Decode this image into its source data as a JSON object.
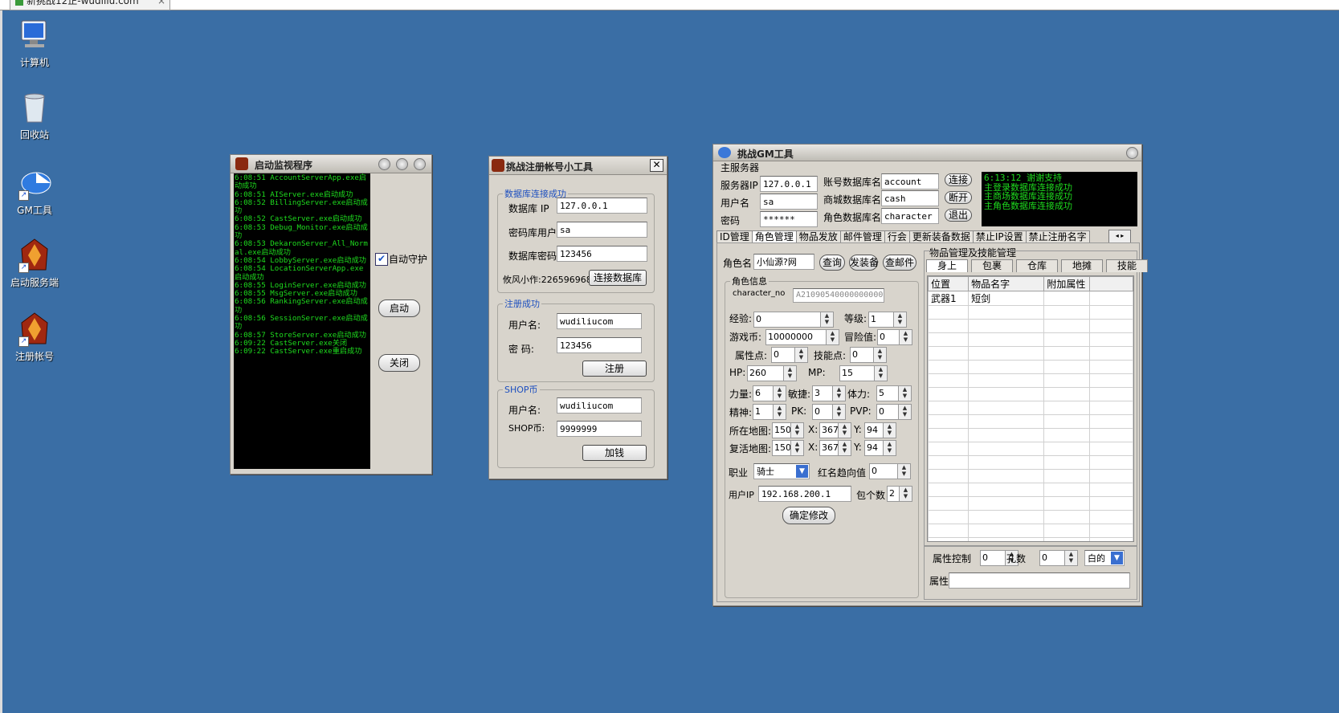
{
  "browser": {
    "tab_title": "新挑战12޸正-wudiliu.com",
    "close": "×"
  },
  "desktop": {
    "icons": [
      {
        "label": "计算机"
      },
      {
        "label": "回收站"
      },
      {
        "label": "GM工具"
      },
      {
        "label": "启动服务端"
      },
      {
        "label": "注册帐号"
      }
    ]
  },
  "monitor": {
    "title": "启动监视程序",
    "log": [
      "6:08:51 AccountServerApp.exe启动成功",
      "6:08:51 AIServer.exe启动成功",
      "6:08:52 BillingServer.exe启动成功",
      "6:08:52 CastServer.exe启动成功",
      "6:08:53 Debug_Monitor.exe启动成功",
      "6:08:53 DekaronServer_All_Normal.exe启动成功",
      "6:08:54 LobbyServer.exe启动成功",
      "6:08:54 LocationServerApp.exe启动成功",
      "6:08:55 LoginServer.exe启动成功",
      "6:08:55 MsgServer.exe启动成功",
      "6:08:56 RankingServer.exe启动成功",
      "6:08:56 SessionServer.exe启动成功",
      "6:08:57 StoreServer.exe启动成功",
      "6:09:22 CastServer.exe关闭",
      "6:09:22 CastServer.exe重启成功"
    ],
    "auto_guard_label": "自动守护",
    "auto_guard_checked": "✔",
    "start_button": "启动",
    "close_button": "关闭"
  },
  "register": {
    "title": "挑战注册帐号小工具",
    "close": "✕",
    "db_group": "数据库连接成功",
    "db_ip_label": "数据库 IP",
    "db_ip": "127.0.0.1",
    "db_user_label": "密码库用户",
    "db_user": "sa",
    "db_pass_label": "数据库密码",
    "db_pass": "123456",
    "credit": "攸风小作:226596968",
    "connect_button": "连接数据库",
    "reg_group": "注册成功",
    "username_label": "用户名:",
    "username": "wudiliucom",
    "password_label": "密  码:",
    "password": "123456",
    "register_button": "注册",
    "shop_group": "SHOP币",
    "shop_user_label": "用户名:",
    "shop_user": "wudiliucom",
    "shop_coin_label": "SHOP币:",
    "shop_coin": "9999999",
    "add_button": "加钱"
  },
  "gm": {
    "title": "挑战GM工具",
    "server_group": "主服务器",
    "server_ip_label": "服务器IP",
    "server_ip": "127.0.0.1",
    "user_label": "用户名",
    "user": "sa",
    "pass_label": "密码",
    "pass": "******",
    "acc_db_label": "账号数据库名",
    "acc_db": "account",
    "shop_db_label": "商城数据库名",
    "shop_db": "cash",
    "char_db_label": "角色数据库名",
    "char_db": "character",
    "connect_button": "连接",
    "disconnect_button": "断开",
    "exit_button": "退出",
    "status": [
      "6:13:12 谢谢支持",
      "主登录数据库连接成功",
      "主商场数据库连接成功",
      "主角色数据库连接成功"
    ],
    "tabs": [
      "ID管理",
      "角色管理",
      "物品发放",
      "邮件管理",
      "行会",
      "更新装备数据",
      "禁止IP设置",
      "禁止注册名字"
    ],
    "char_name_label": "角色名",
    "char_name": "小仙源?网",
    "query_button": "查询",
    "equip_button": "发装备",
    "mail_button": "查邮件",
    "info_group": "角色信息",
    "char_no_label": "character_no",
    "char_no": "A210905400000000001",
    "exp_label": "经验:",
    "exp": "0",
    "level_label": "等级:",
    "level": "1",
    "money_label": "游戏币:",
    "money": "10000000",
    "adventure_label": "冒险值:",
    "adventure": "0",
    "attr_label": "属性点:",
    "attr": "0",
    "skill_pt_label": "技能点:",
    "skill_pt": "0",
    "hp_label": "HP:",
    "hp": "260",
    "mp_label": "MP:",
    "mp": "15",
    "str_label": "力量:",
    "str": "6",
    "agi_label": "敏捷:",
    "agi": "3",
    "vit_label": "体力:",
    "vit": "5",
    "spi_label": "精神:",
    "spi": "1",
    "pk_label": "PK:",
    "pk": "0",
    "pvp_label": "PVP:",
    "pvp": "0",
    "map_label": "所在地图:",
    "map": "150",
    "x_label": "X:",
    "x": "367",
    "y_label": "Y:",
    "y": "94",
    "revive_label": "复活地图:",
    "revive": "150",
    "rx": "367",
    "ry": "94",
    "job_label": "职业",
    "job": "骑士",
    "red_label": "红名趋向值",
    "red": "0",
    "ip_label": "用户IP",
    "ip": "192.168.200.1",
    "bag_label": "包个数",
    "bag": "2",
    "confirm_button": "确定修改",
    "items_group": "物品管理及技能管理",
    "item_tabs": [
      "身上",
      "包裹",
      "仓库",
      "地摊",
      "技能"
    ],
    "columns": [
      "位置",
      "物品名字",
      "附加属性"
    ],
    "rows": [
      [
        "武器1",
        "短剑",
        ""
      ]
    ],
    "attr_ctrl_label": "属性控制",
    "attr_ctrl": "0",
    "holes_label": "孔数",
    "holes": "0",
    "color": "白的",
    "prop_label": "属性"
  }
}
